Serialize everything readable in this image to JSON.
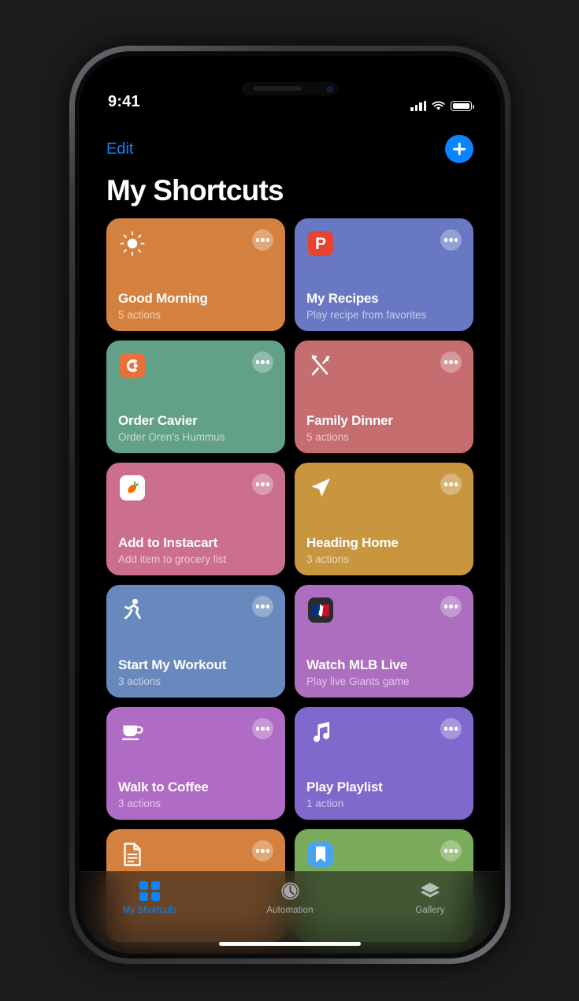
{
  "status_bar": {
    "time": "9:41",
    "signal_icon": "cellular-signal-icon",
    "wifi_icon": "wifi-icon",
    "battery_icon": "battery-full-icon"
  },
  "nav": {
    "edit_label": "Edit",
    "add_icon": "plus-icon"
  },
  "header": {
    "title": "My Shortcuts"
  },
  "shortcuts": [
    {
      "title": "Good Morning",
      "subtitle": "5 actions",
      "color": "#d4813f",
      "icon": "sun-icon",
      "more_icon": "ellipsis-icon"
    },
    {
      "title": "My Recipes",
      "subtitle": "Play recipe from favorites",
      "color": "#6878c2",
      "icon": "paprika-app-icon",
      "badge_letter": "P",
      "badge_color": "#e8432e",
      "more_icon": "ellipsis-icon"
    },
    {
      "title": "Order Cavier",
      "subtitle": "Order Oren's Hummus",
      "color": "#62a087",
      "icon": "caviar-app-icon",
      "badge_color": "#e8703a",
      "more_icon": "ellipsis-icon"
    },
    {
      "title": "Family Dinner",
      "subtitle": "5 actions",
      "color": "#c66d70",
      "icon": "fork-knife-icon",
      "more_icon": "ellipsis-icon"
    },
    {
      "title": "Add to Instacart",
      "subtitle": "Add item to grocery list",
      "color": "#cc6f8c",
      "icon": "instacart-app-icon",
      "badge_color": "#ffffff",
      "more_icon": "ellipsis-icon"
    },
    {
      "title": "Heading Home",
      "subtitle": "3 actions",
      "color": "#c99640",
      "icon": "navigation-arrow-icon",
      "more_icon": "ellipsis-icon"
    },
    {
      "title": "Start My Workout",
      "subtitle": "3 actions",
      "color": "#6889bd",
      "icon": "running-person-icon",
      "more_icon": "ellipsis-icon"
    },
    {
      "title": "Watch MLB Live",
      "subtitle": "Play live Giants game",
      "color": "#ad6ec0",
      "icon": "mlb-app-icon",
      "badge_color": "#2b2b2d",
      "more_icon": "ellipsis-icon"
    },
    {
      "title": "Walk to Coffee",
      "subtitle": "3 actions",
      "color": "#b06bc4",
      "icon": "coffee-cup-icon",
      "more_icon": "ellipsis-icon"
    },
    {
      "title": "Play Playlist",
      "subtitle": "1 action",
      "color": "#8069cc",
      "icon": "music-note-icon",
      "more_icon": "ellipsis-icon"
    },
    {
      "title": "",
      "subtitle": "",
      "color": "#d4813f",
      "icon": "document-icon",
      "more_icon": "ellipsis-icon"
    },
    {
      "title": "",
      "subtitle": "",
      "color": "#79ab5a",
      "icon": "bookmark-app-icon",
      "badge_color": "#4aa3f0",
      "more_icon": "ellipsis-icon"
    }
  ],
  "tab_bar": [
    {
      "label": "My Shortcuts",
      "icon": "grid-squares-icon",
      "active": true
    },
    {
      "label": "Automation",
      "icon": "clock-automation-icon",
      "active": false
    },
    {
      "label": "Gallery",
      "icon": "layers-icon",
      "active": false
    }
  ],
  "theme": {
    "accent": "#0a84ff",
    "background": "#000000"
  }
}
